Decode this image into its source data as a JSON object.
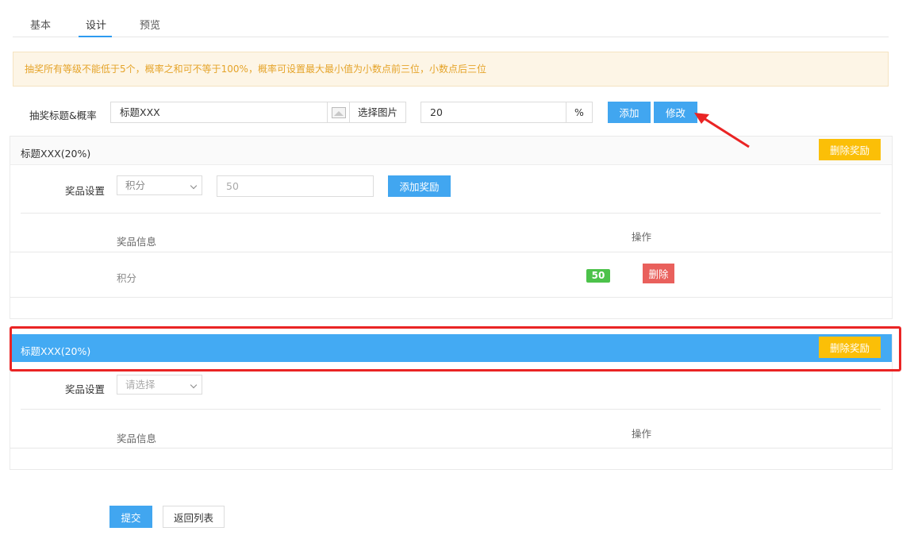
{
  "tabs": [
    {
      "label": "基本"
    },
    {
      "label": "设计"
    },
    {
      "label": "预览"
    }
  ],
  "notice": "抽奖所有等级不能低于5个，概率之和可不等于100%，概率可设置最大最小值为小数点前三位，小数点后三位",
  "form": {
    "label": "抽奖标题&概率",
    "title_value": "标题XXX",
    "choose_image_label": "选择图片",
    "probability_value": "20",
    "percent_symbol": "%",
    "add_label": "添加",
    "modify_label": "修改"
  },
  "groups": [
    {
      "title": "标题XXX(20%)",
      "delete_reward_label": "删除奖励",
      "prize_setting_label": "奖品设置",
      "select_value": "积分",
      "points_placeholder": "50",
      "add_reward_label": "添加奖励",
      "col_info": "奖品信息",
      "col_action": "操作",
      "rows": [
        {
          "info": "积分",
          "badge": "50",
          "delete_label": "删除"
        }
      ]
    },
    {
      "title": "标题XXX(20%)",
      "delete_reward_label": "删除奖励",
      "prize_setting_label": "奖品设置",
      "select_placeholder": "请选择",
      "col_info": "奖品信息",
      "col_action": "操作"
    }
  ],
  "footer": {
    "submit_label": "提交",
    "back_label": "返回列表"
  },
  "colors": {
    "primary": "#41a6f0",
    "warning": "#fbbf07",
    "danger": "#e9605c",
    "success": "#4cc24a",
    "highlight_frame": "#ea2424"
  }
}
